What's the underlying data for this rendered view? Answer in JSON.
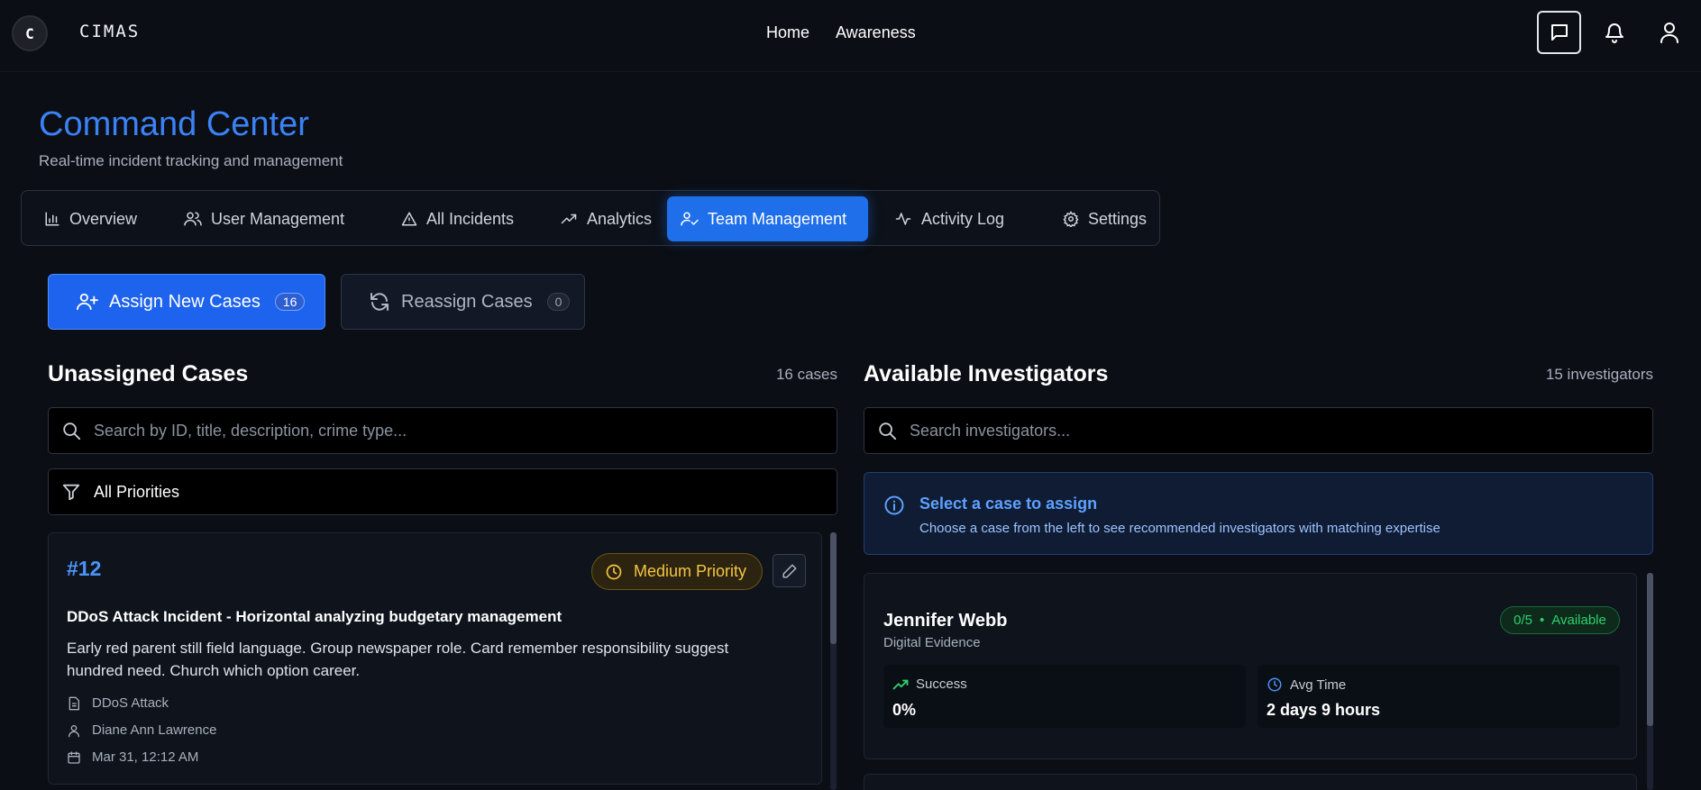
{
  "app": {
    "brand": "CIMAS",
    "logo_letter": "C"
  },
  "topnav": {
    "home": "Home",
    "awareness": "Awareness"
  },
  "header": {
    "title": "Command Center",
    "subtitle": "Real-time incident tracking and management"
  },
  "tabs": [
    {
      "label": "Overview",
      "icon": "bar-chart-icon",
      "active": false
    },
    {
      "label": "User Management",
      "icon": "users-icon",
      "active": false
    },
    {
      "label": "All Incidents",
      "icon": "alert-triangle-icon",
      "active": false
    },
    {
      "label": "Analytics",
      "icon": "trending-up-icon",
      "active": false
    },
    {
      "label": "Team Management",
      "icon": "user-check-icon",
      "active": true
    },
    {
      "label": "Activity Log",
      "icon": "activity-icon",
      "active": false
    },
    {
      "label": "Settings",
      "icon": "gear-icon",
      "active": false
    }
  ],
  "actions": {
    "assign_label": "Assign New Cases",
    "assign_count": "16",
    "reassign_label": "Reassign Cases",
    "reassign_count": "0"
  },
  "unassigned": {
    "title": "Unassigned Cases",
    "count": "16 cases",
    "search_placeholder": "Search by ID, title, description, crime type...",
    "filter_value": "All Priorities",
    "cases": [
      {
        "id": "#12",
        "priority": "Medium Priority",
        "title": "DDoS Attack Incident - Horizontal analyzing budgetary management",
        "description": "Early red parent still field language. Group newspaper role. Card remember responsibility suggest hundred need. Church which option career.",
        "crime_type": "DDoS Attack",
        "reporter": "Diane Ann Lawrence",
        "date": "Mar 31, 12:12 AM"
      }
    ]
  },
  "investigators": {
    "title": "Available Investigators",
    "count": "15 investigators",
    "search_placeholder": "Search investigators...",
    "info_title": "Select a case to assign",
    "info_text": "Choose a case from the left to see recommended investigators with matching expertise",
    "list": [
      {
        "name": "Jennifer Webb",
        "specialty": "Digital Evidence",
        "load": "0/5",
        "status": "Available",
        "success_label": "Success",
        "success_value": "0%",
        "avg_label": "Avg Time",
        "avg_value": "2 days 9 hours"
      }
    ]
  },
  "colors": {
    "accent": "#1f6feb",
    "title_blue": "#3b82f6",
    "priority_medium": "#f5c542",
    "available_green": "#2ed16f",
    "background": "#0b0e14"
  }
}
